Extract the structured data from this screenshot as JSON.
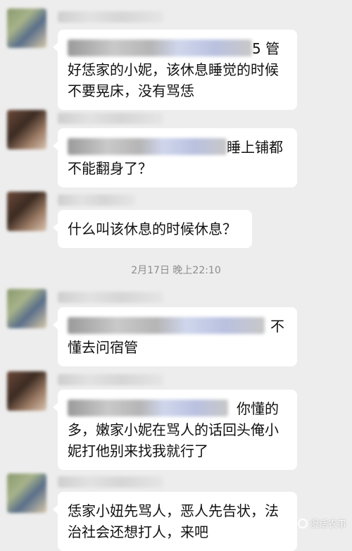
{
  "messages": [
    {
      "lines": [
        "",
        "好恁家的小妮，该休息睡觉的时候",
        "不要晃床，没有骂恁"
      ],
      "first_suffix": "5 管"
    },
    {
      "lines": [
        "",
        "不能翻身了？"
      ],
      "first_suffix": "睡上铺都"
    },
    {
      "lines": [
        "什么叫该休息的时候休息？"
      ],
      "first_suffix": ""
    },
    {
      "lines": [
        "",
        "懂去问宿管"
      ],
      "first_suffix": "不"
    },
    {
      "lines": [
        "",
        "多，嫩家小妮在骂人的话回头俺小",
        "妮打他别来找我就行了"
      ],
      "first_suffix": "你懂的"
    },
    {
      "lines": [
        "恁家小妞先骂人，恶人先告状，法",
        "治社会还想打人，来吧"
      ],
      "first_suffix": ""
    }
  ],
  "timestamp": "2月17日 晚上22:10",
  "watermark": "漫话农事",
  "colors": {
    "background": "#ededed",
    "bubble": "#ffffff",
    "timestamp": "#8c8c8c"
  }
}
